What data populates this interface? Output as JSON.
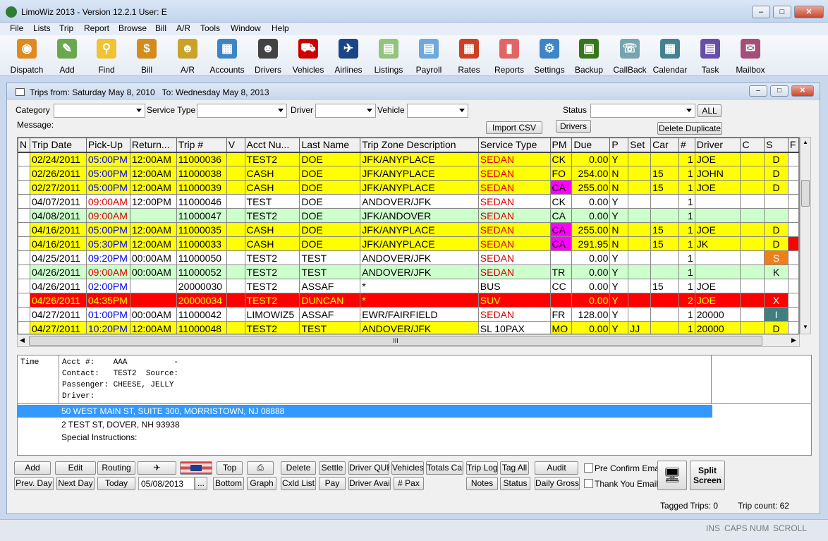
{
  "window": {
    "title": "LimoWiz 2013 - Version 12.2.1   User: E",
    "app_icon_text": "LMW"
  },
  "menu": [
    "File",
    "Lists",
    "Trip",
    "Report",
    "Browse",
    "Bill",
    "A/R",
    "Tools",
    "Window",
    "Help"
  ],
  "toolbar": [
    {
      "label": "Dispatch",
      "icon": "globe-icon",
      "color": "#e08a1e"
    },
    {
      "label": "Add",
      "icon": "pen-add-icon",
      "color": "#6aa84f"
    },
    {
      "label": "Find",
      "icon": "magnifier-icon",
      "color": "#f1c232"
    },
    {
      "label": "Bill",
      "icon": "money-bag-icon",
      "color": "#d48b1a"
    },
    {
      "label": "A/R",
      "icon": "people-icon",
      "color": "#c9a227"
    },
    {
      "label": "Accounts",
      "icon": "accounts-icon",
      "color": "#3d85c6"
    },
    {
      "label": "Drivers",
      "icon": "drivers-icon",
      "color": "#434343"
    },
    {
      "label": "Vehicles",
      "icon": "car-icon",
      "color": "#cc0000"
    },
    {
      "label": "Airlines",
      "icon": "airplane-icon",
      "color": "#1c4587"
    },
    {
      "label": "Listings",
      "icon": "listings-icon",
      "color": "#93c47d"
    },
    {
      "label": "Payroll",
      "icon": "payroll-icon",
      "color": "#6fa8dc"
    },
    {
      "label": "Rates",
      "icon": "rates-icon",
      "color": "#cc4125"
    },
    {
      "label": "Reports",
      "icon": "reports-icon",
      "color": "#e06666"
    },
    {
      "label": "Settings",
      "icon": "gear-icon",
      "color": "#3d85c6"
    },
    {
      "label": "Backup",
      "icon": "backup-icon",
      "color": "#38761d"
    },
    {
      "label": "CallBack",
      "icon": "callback-icon",
      "color": "#76a5af"
    },
    {
      "label": "Calendar",
      "icon": "calendar-icon",
      "color": "#45818e"
    },
    {
      "label": "Task",
      "icon": "task-icon",
      "color": "#674ea7"
    },
    {
      "label": "Mailbox",
      "icon": "mailbox-icon",
      "color": "#a64d79"
    }
  ],
  "child": {
    "title_from": "Trips from: Saturday May 8, 2010",
    "title_to": "To: Wednesday May 8, 2013"
  },
  "filters": {
    "category_label": "Category",
    "service_type_label": "Service Type",
    "driver_label": "Driver",
    "vehicle_label": "Vehicle",
    "status_label": "Status",
    "message_label": "Message:",
    "all_button": "ALL",
    "import_csv_button": "Import CSV",
    "drivers_button": "Drivers",
    "delete_duplicate_button": "Delete Duplicate"
  },
  "grid": {
    "columns": [
      "N",
      "Trip Date",
      "Pick-Up",
      "Return...",
      "Trip #",
      "V",
      "Acct Nu...",
      "Last Name",
      "Trip Zone Description",
      "Service Type",
      "PM",
      "Due",
      "P",
      "Set",
      "Car",
      "#",
      "Driver",
      "C",
      "S",
      "F"
    ],
    "rows": [
      {
        "bg": "#ffff00",
        "date": "02/24/2011",
        "pickup": "05:00PM",
        "pickup_color": "#0000ff",
        "ret": "12:00AM",
        "trip": "11000036",
        "acct": "TEST2",
        "last": "DOE",
        "zone": "JFK/ANYPLACE",
        "svc": "SEDAN",
        "svc_color": "#e00000",
        "pm": "CK",
        "pm_bg": "",
        "due": "0.00",
        "p": "Y",
        "set": "",
        "car": "",
        "num": "1",
        "driver": "JOE",
        "s": "D",
        "s_bg": "",
        "s_color": "#000000"
      },
      {
        "bg": "#ffff00",
        "date": "02/26/2011",
        "pickup": "05:00PM",
        "pickup_color": "#0000ff",
        "ret": "12:00AM",
        "trip": "11000038",
        "acct": "CASH",
        "last": "DOE",
        "zone": "JFK/ANYPLACE",
        "svc": "SEDAN",
        "svc_color": "#e00000",
        "pm": "FO",
        "pm_bg": "",
        "due": "254.00",
        "p": "N",
        "set": "",
        "car": "15",
        "num": "1",
        "driver": "JOHN",
        "s": "D",
        "s_bg": "",
        "s_color": "#000000"
      },
      {
        "bg": "#ffff00",
        "date": "02/27/2011",
        "pickup": "05:00PM",
        "pickup_color": "#0000ff",
        "ret": "12:00AM",
        "trip": "11000039",
        "acct": "CASH",
        "last": "DOE",
        "zone": "JFK/ANYPLACE",
        "svc": "SEDAN",
        "svc_color": "#e00000",
        "pm": "CA",
        "pm_bg": "#ff00ff",
        "due": "255.00",
        "p": "N",
        "set": "",
        "car": "15",
        "num": "1",
        "driver": "JOE",
        "s": "D",
        "s_bg": "",
        "s_color": "#000000"
      },
      {
        "bg": "#ffffff",
        "date": "04/07/2011",
        "pickup": "09:00AM",
        "pickup_color": "#e00000",
        "ret": "12:00PM",
        "trip": "11000046",
        "acct": "TEST",
        "last": "DOE",
        "zone": "ANDOVER/JFK",
        "svc": "SEDAN",
        "svc_color": "#e00000",
        "pm": "CK",
        "pm_bg": "",
        "due": "0.00",
        "p": "Y",
        "set": "",
        "car": "",
        "num": "1",
        "driver": "",
        "s": "",
        "s_bg": "",
        "s_color": "#000000"
      },
      {
        "bg": "#ccffcc",
        "date": "04/08/2011",
        "pickup": "09:00AM",
        "pickup_color": "#e00000",
        "ret": "",
        "trip": "11000047",
        "acct": "TEST2",
        "last": "DOE",
        "zone": "JFK/ANDOVER",
        "svc": "SEDAN",
        "svc_color": "#e00000",
        "pm": "CA",
        "pm_bg": "",
        "due": "0.00",
        "p": "Y",
        "set": "",
        "car": "",
        "num": "1",
        "driver": "",
        "s": "",
        "s_bg": "",
        "s_color": "#000000"
      },
      {
        "bg": "#ffff00",
        "date": "04/16/2011",
        "pickup": "05:00PM",
        "pickup_color": "#0000ff",
        "ret": "12:00AM",
        "trip": "11000035",
        "acct": "CASH",
        "last": "DOE",
        "zone": "JFK/ANYPLACE",
        "svc": "SEDAN",
        "svc_color": "#e00000",
        "pm": "CA",
        "pm_bg": "#ff00ff",
        "due": "255.00",
        "p": "N",
        "set": "",
        "car": "15",
        "num": "1",
        "driver": "JOE",
        "s": "D",
        "s_bg": "",
        "s_color": "#000000"
      },
      {
        "bg": "#ffff00",
        "date": "04/16/2011",
        "pickup": "05:30PM",
        "pickup_color": "#0000ff",
        "ret": "12:00AM",
        "trip": "11000033",
        "acct": "CASH",
        "last": "DOE",
        "zone": "JFK/ANYPLACE",
        "svc": "SEDAN",
        "svc_color": "#e00000",
        "pm": "CA",
        "pm_bg": "#ff00ff",
        "due": "291.95",
        "p": "N",
        "set": "",
        "car": "15",
        "num": "1",
        "driver": "JK",
        "s": "D",
        "s_bg": "",
        "s_color": "#000000"
      },
      {
        "bg": "#ffffff",
        "date": "04/25/2011",
        "pickup": "09:20PM",
        "pickup_color": "#0000ff",
        "ret": "00:00AM",
        "trip": "11000050",
        "acct": "TEST2",
        "last": "TEST",
        "zone": "ANDOVER/JFK",
        "svc": "SEDAN",
        "svc_color": "#e00000",
        "pm": "",
        "pm_bg": "",
        "due": "0.00",
        "p": "Y",
        "set": "",
        "car": "",
        "num": "1",
        "driver": "",
        "s": "S",
        "s_bg": "#f07f1b",
        "s_color": "#ffffff"
      },
      {
        "bg": "#ccffcc",
        "date": "04/26/2011",
        "pickup": "09:00AM",
        "pickup_color": "#e00000",
        "ret": "00:00AM",
        "trip": "11000052",
        "acct": "TEST2",
        "last": "TEST",
        "zone": "ANDOVER/JFK",
        "svc": "SEDAN",
        "svc_color": "#e00000",
        "pm": "TR",
        "pm_bg": "",
        "due": "0.00",
        "p": "Y",
        "set": "",
        "car": "",
        "num": "1",
        "driver": "",
        "s": "K",
        "s_bg": "",
        "s_color": "#000000"
      },
      {
        "bg": "#ffffff",
        "date": "04/26/2011",
        "pickup": "02:00PM",
        "pickup_color": "#0000ff",
        "ret": "",
        "trip": "20000030",
        "acct": "TEST2",
        "last": "ASSAF",
        "zone": "*",
        "svc": "BUS",
        "svc_color": "#000000",
        "pm": "CC",
        "pm_bg": "",
        "due": "0.00",
        "p": "Y",
        "set": "",
        "car": "15",
        "num": "1",
        "driver": "JOE",
        "s": "",
        "s_bg": "",
        "s_color": "#000000"
      },
      {
        "bg": "#ff0000",
        "date": "04/26/2011",
        "pickup": "04:35PM",
        "pickup_color": "#ffff00",
        "ret": "",
        "trip": "20000034",
        "acct": "TEST2",
        "last": "DUNCAN",
        "zone": "*",
        "svc": "SUV",
        "svc_color": "#ffff00",
        "pm": "",
        "pm_bg": "",
        "due": "0.00",
        "p": "Y",
        "set": "",
        "car": "",
        "num": "2",
        "driver": "JOE",
        "s": "X",
        "s_bg": "",
        "s_color": "#ffffff",
        "red": true
      },
      {
        "bg": "#ffffff",
        "date": "04/27/2011",
        "pickup": "01:00PM",
        "pickup_color": "#0000ff",
        "ret": "00:00AM",
        "trip": "11000042",
        "acct": "LIMOWIZ5",
        "last": "ASSAF",
        "zone": "EWR/FAIRFIELD",
        "svc": "SEDAN",
        "svc_color": "#e00000",
        "pm": "FR",
        "pm_bg": "",
        "due": "128.00",
        "p": "Y",
        "set": "",
        "car": "",
        "num": "1",
        "driver": "20000",
        "s": "I",
        "s_bg": "#3f7f7f",
        "s_color": "#ffffff"
      },
      {
        "bg": "#ffff00",
        "date": "04/27/2011",
        "pickup": "10:20PM",
        "pickup_color": "#0000ff",
        "ret": "12:00AM",
        "trip": "11000048",
        "acct": "TEST2",
        "last": "TEST",
        "zone": "ANDOVER/JFK",
        "svc": "SL 10PAX",
        "svc_color": "#000000",
        "svc_bg": "#ffffff",
        "pm": "MO",
        "pm_bg": "",
        "due": "0.00",
        "p": "Y",
        "set": "JJ",
        "car": "",
        "num": "1",
        "driver": "20000",
        "s": "D",
        "s_bg": "",
        "s_color": "#000000"
      }
    ],
    "hscroll_grip": "III"
  },
  "details": {
    "time_label": "Time",
    "acct_line": "Acct #:    AAA          -",
    "contact_line": "Contact:   TEST2  Source:",
    "passenger_line": "Passenger: CHEESE, JELLY",
    "driver_line": "Driver:",
    "address_selected": "50 WEST MAIN ST, SUITE 300, MORRISTOWN, NJ 08888",
    "address_2": "2 TEST ST, DOVER, NH 93938",
    "special_instructions": "Special Instructions:"
  },
  "buttons": {
    "add": "Add",
    "edit": "Edit",
    "routing": "Routing",
    "top": "Top",
    "delete": "Delete",
    "settle": "Settle",
    "driver_que": "Driver QUE",
    "vehicles": "Vehicles",
    "totals_cal": "Totals Cal",
    "trip_log": "Trip Log",
    "tag_all": "Tag All",
    "audit": "Audit",
    "prev_day": "Prev. Day",
    "next_day": "Next Day",
    "today": "Today",
    "date_value": "05/08/2013",
    "ellipsis": "...",
    "bottom": "Bottom",
    "graph": "Graph",
    "cxld_list": "Cxld List",
    "pay": "Pay",
    "driver_avail": "Driver Avail",
    "pax": "# Pax",
    "notes": "Notes",
    "status": "Status",
    "daily_gross": "Daily Gross",
    "pre_confirm_email": "Pre Confirm Email",
    "thank_you_email": "Thank You Email",
    "split_screen": "Split Screen"
  },
  "status": {
    "tagged_trips": "Tagged Trips: 0",
    "trip_count": "Trip count: 62",
    "ins": "INS",
    "caps": "CAPS",
    "num": "NUM",
    "scroll": "SCROLL"
  }
}
